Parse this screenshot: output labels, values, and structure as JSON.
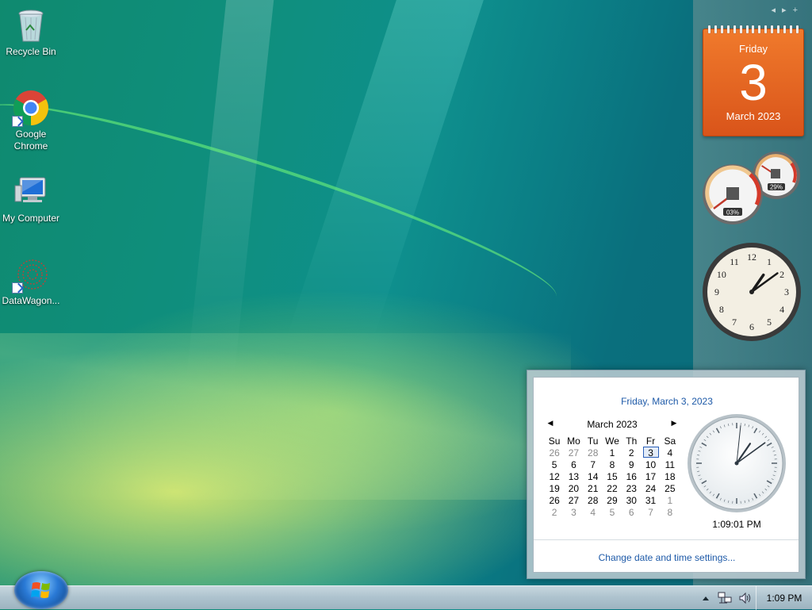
{
  "desktop": {
    "icons": [
      {
        "label": "Recycle Bin",
        "icon": "recycle-bin-icon"
      },
      {
        "label": "Google Chrome",
        "icon": "chrome-icon"
      },
      {
        "label": "My Computer",
        "icon": "computer-icon"
      },
      {
        "label": "DataWagon...",
        "icon": "datawagon-icon"
      }
    ]
  },
  "sidebar": {
    "calendar_gadget": {
      "weekday": "Friday",
      "day": "3",
      "month_year": "March 2023"
    },
    "meter_gadget": {
      "cpu_percent": "03%",
      "memory_percent": "29%",
      "cpu_value": 3,
      "memory_value": 29
    },
    "clock_gadget": {
      "hour": 1,
      "minute": 9
    }
  },
  "popup": {
    "long_date": "Friday, March 3, 2023",
    "month_title": "March 2023",
    "prev_icon": "triangle-left-icon",
    "next_icon": "triangle-right-icon",
    "weekdays": [
      "Su",
      "Mo",
      "Tu",
      "We",
      "Th",
      "Fr",
      "Sa"
    ],
    "weeks": [
      [
        "26",
        "27",
        "28",
        "1",
        "2",
        "3",
        "4"
      ],
      [
        "5",
        "6",
        "7",
        "8",
        "9",
        "10",
        "11"
      ],
      [
        "12",
        "13",
        "14",
        "15",
        "16",
        "17",
        "18"
      ],
      [
        "19",
        "20",
        "21",
        "22",
        "23",
        "24",
        "25"
      ],
      [
        "26",
        "27",
        "28",
        "29",
        "30",
        "31",
        "1"
      ],
      [
        "2",
        "3",
        "4",
        "5",
        "6",
        "7",
        "8"
      ]
    ],
    "digital_time": "1:09:01 PM",
    "clock": {
      "hour": 1,
      "minute": 9,
      "second": 1
    },
    "change_link": "Change date and time settings..."
  },
  "taskbar": {
    "clock": "1:09 PM",
    "tray_icons": [
      "show-hidden-icons-icon",
      "network-icon",
      "volume-icon"
    ]
  },
  "colors": {
    "accent_link": "#1e5aa8",
    "calendar_gadget": "#e8611f"
  }
}
